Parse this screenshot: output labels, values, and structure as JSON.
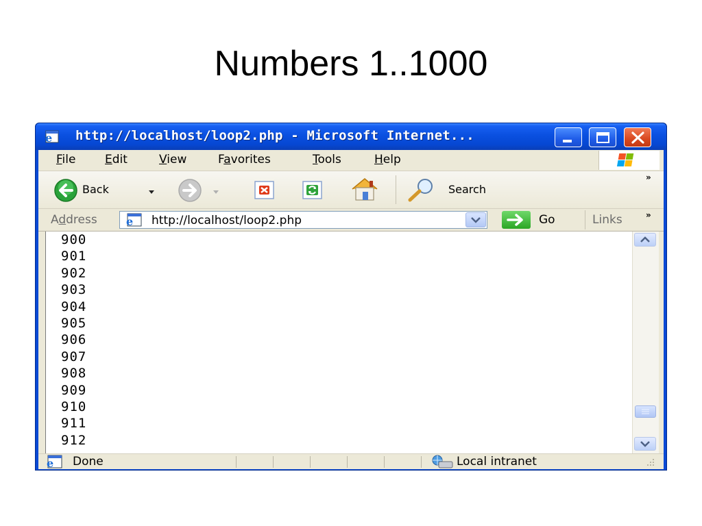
{
  "slide": {
    "title": "Numbers 1..1000"
  },
  "window": {
    "title": "http://localhost/loop2.php - Microsoft Internet...",
    "icon": "ie-page-icon",
    "controls": [
      "minimize-icon",
      "maximize-icon",
      "close-icon"
    ]
  },
  "menubar": {
    "items": [
      {
        "key": "F",
        "rest": "ile"
      },
      {
        "key": "E",
        "rest": "dit"
      },
      {
        "key": "V",
        "rest": "iew"
      },
      {
        "prefix": "F",
        "key": "a",
        "rest": "vorites"
      },
      {
        "key": "T",
        "rest": "ools"
      },
      {
        "key": "H",
        "rest": "elp"
      }
    ]
  },
  "toolbar": {
    "back_label": "Back",
    "search_label": "Search",
    "overflow": "»"
  },
  "address": {
    "label_prefix": "A",
    "label_key": "d",
    "label_rest": "dress",
    "url": "http://localhost/loop2.php",
    "go_label": "Go",
    "links_label": "Links",
    "links_overflow": "»"
  },
  "content": {
    "numbers": [
      "900",
      "901",
      "902",
      "903",
      "904",
      "905",
      "906",
      "907",
      "908",
      "909",
      "910",
      "911",
      "912"
    ]
  },
  "statusbar": {
    "status": "Done",
    "zone": "Local intranet"
  },
  "colors": {
    "titlebar": "#0a50e0",
    "close_button": "#d94820",
    "go_button": "#2ba624",
    "chrome": "#ece9d8"
  }
}
